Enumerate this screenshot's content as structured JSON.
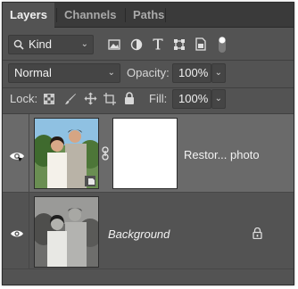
{
  "tabs": [
    {
      "label": "Layers",
      "active": true
    },
    {
      "label": "Channels",
      "active": false
    },
    {
      "label": "Paths",
      "active": false
    }
  ],
  "filter": {
    "kind_label": "Kind",
    "icons": [
      "pixel-filter-icon",
      "adjustment-filter-icon",
      "type-filter-icon",
      "shape-filter-icon",
      "smart-object-filter-icon",
      "filter-toggle-icon"
    ]
  },
  "blend": {
    "mode": "Normal",
    "opacity_label": "Opacity:",
    "opacity_value": "100%"
  },
  "lock": {
    "label": "Lock:",
    "icons": [
      "lock-transparent-pixels-icon",
      "lock-image-pixels-icon",
      "lock-position-icon",
      "lock-artboard-icon",
      "lock-all-icon"
    ],
    "fill_label": "Fill:",
    "fill_value": "100%"
  },
  "layers": [
    {
      "name": "Restor... photo",
      "selected": true,
      "visible": true,
      "has_mask": true,
      "thumbnail": "color-photo",
      "locked": false
    },
    {
      "name": "Background",
      "selected": false,
      "visible": true,
      "has_mask": false,
      "thumbnail": "bw-photo",
      "locked": true
    }
  ],
  "colors": {
    "panel_bg": "#535353",
    "tab_bar": "#3a3a3a",
    "selected_row": "#6a6a6a",
    "field_bg": "#454545"
  }
}
